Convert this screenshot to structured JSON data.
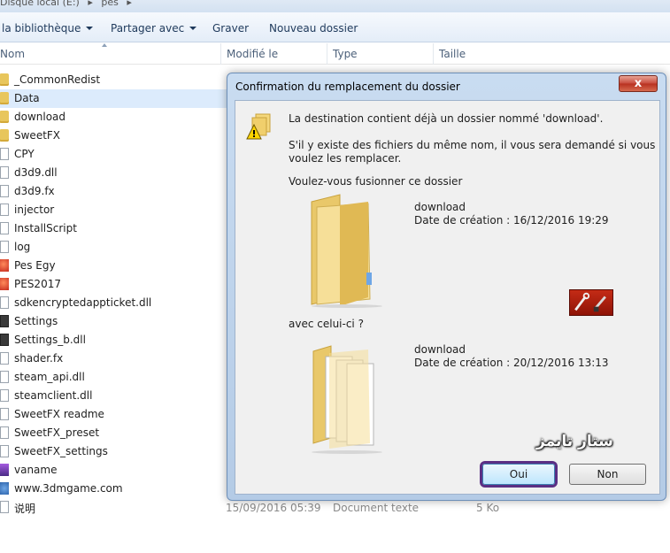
{
  "breadcrumb": [
    "Disque local (E:)",
    "pes"
  ],
  "toolbar": {
    "library": "la bibliothèque",
    "share": "Partager avec",
    "burn": "Graver",
    "new_folder": "Nouveau dossier"
  },
  "columns": {
    "name": "Nom",
    "modified": "Modifié le",
    "type": "Type",
    "size": "Taille"
  },
  "files": [
    {
      "name": "_CommonRedist",
      "icon": "folder-icon"
    },
    {
      "name": "Data",
      "icon": "folder-icon",
      "selected": true
    },
    {
      "name": "download",
      "icon": "folder-icon"
    },
    {
      "name": "SweetFX",
      "icon": "folder-icon"
    },
    {
      "name": "CPY",
      "icon": "file-icon"
    },
    {
      "name": "d3d9.dll",
      "icon": "file-icon"
    },
    {
      "name": "d3d9.fx",
      "icon": "file-icon"
    },
    {
      "name": "injector",
      "icon": "file-icon"
    },
    {
      "name": "InstallScript",
      "icon": "script-icon"
    },
    {
      "name": "log",
      "icon": "file-icon"
    },
    {
      "name": "Pes Egy",
      "icon": "app-icon"
    },
    {
      "name": "PES2017",
      "icon": "app-icon"
    },
    {
      "name": "sdkencryptedappticket.dll",
      "icon": "dll-icon"
    },
    {
      "name": "Settings",
      "icon": "gear-icon"
    },
    {
      "name": "Settings_b.dll",
      "icon": "gear-icon"
    },
    {
      "name": "shader.fx",
      "icon": "file-icon"
    },
    {
      "name": "steam_api.dll",
      "icon": "dll-icon"
    },
    {
      "name": "steamclient.dll",
      "icon": "dll-icon"
    },
    {
      "name": "SweetFX readme",
      "icon": "file-icon"
    },
    {
      "name": "SweetFX_preset",
      "icon": "file-icon"
    },
    {
      "name": "SweetFX_settings",
      "icon": "file-icon"
    },
    {
      "name": "vaname",
      "icon": "bitmap-icon"
    },
    {
      "name": "www.3dmgame.com",
      "icon": "web-icon"
    },
    {
      "name": "说明",
      "icon": "file-icon"
    }
  ],
  "last_file_details": {
    "modified": "15/09/2016 05:39",
    "type": "Document texte",
    "size": "5 Ko"
  },
  "dialog": {
    "title": "Confirmation du remplacement du dossier",
    "close_label": "x",
    "line1": "La destination contient déjà un dossier nommé 'download'.",
    "line2": "S'il y existe des fichiers du même nom, il vous sera demandé si vous voulez les remplacer.",
    "question": "Voulez-vous fusionner ce dossier",
    "existing": {
      "name": "download",
      "date": "Date de création : 16/12/2016 19:29"
    },
    "with_this": "avec celui-ci ?",
    "incoming": {
      "name": "download",
      "date": "Date de création : 20/12/2016 13:13"
    },
    "watermark": "ستار تايمز",
    "yes_label": "Oui",
    "no_label": "Non"
  },
  "colors": {
    "accent": "#3c7fb1",
    "selection": "#dcebfc",
    "focus_ring": "#5b2f84",
    "close": "#c7483a"
  }
}
